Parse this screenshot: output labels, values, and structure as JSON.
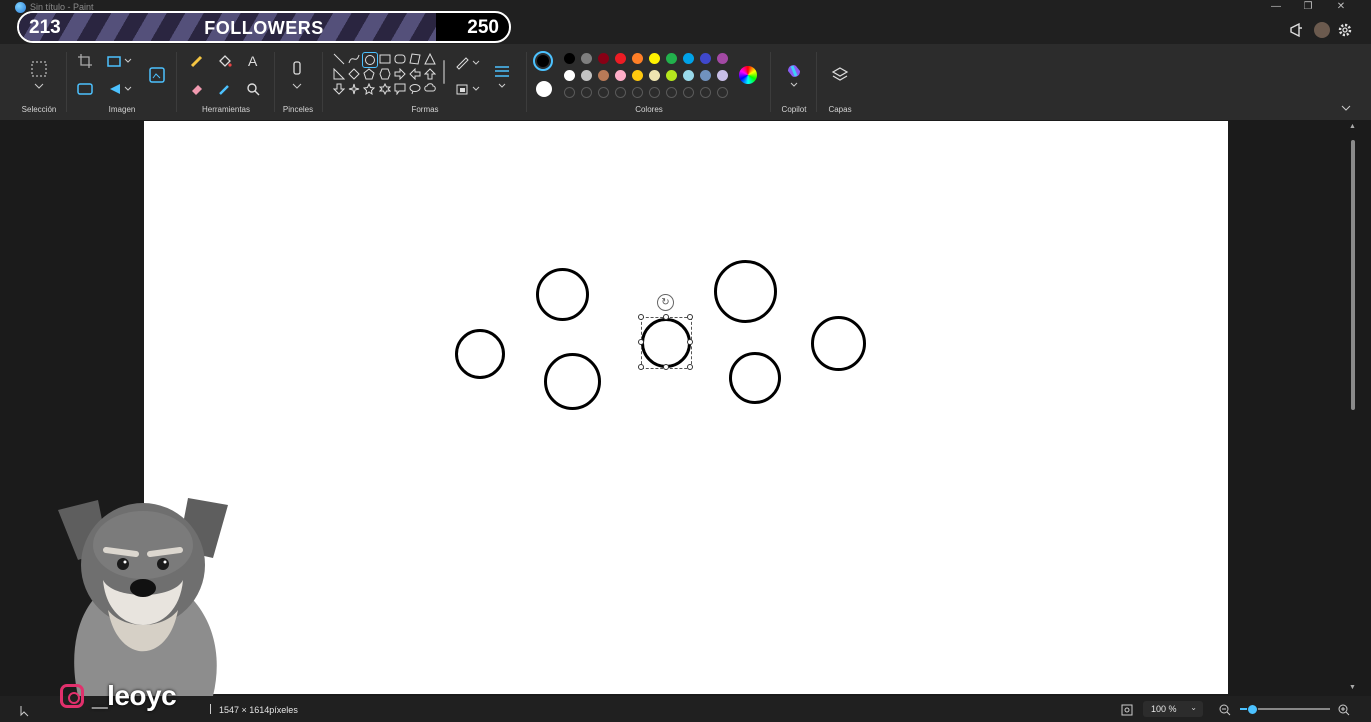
{
  "window": {
    "title": "Sin título - Paint"
  },
  "overlay": {
    "current": "213",
    "label": "FOLLOWERS",
    "goal": "250",
    "progress": 0.852,
    "social_handle": "_leoyc"
  },
  "ribbon": {
    "groups": {
      "selection": "Selección",
      "image": "Imagen",
      "tools": "Herramientas",
      "brushes": "Pinceles",
      "shapes": "Formas",
      "colors": "Colores",
      "copilot": "Copilot",
      "layers": "Capas"
    },
    "palette_row1": [
      "#000000",
      "#7f7f7f",
      "#880015",
      "#ed1c24",
      "#ff7f27",
      "#fff200",
      "#22b14c",
      "#00a2e8",
      "#3f48cc",
      "#a349a4"
    ],
    "palette_row2": [
      "#ffffff",
      "#c3c3c3",
      "#b97a57",
      "#ffaec9",
      "#ffc90e",
      "#efe4b0",
      "#b5e61d",
      "#99d9ea",
      "#7092be",
      "#c8bfe7"
    ],
    "primary_color": "#000000",
    "secondary_color": "#ffffff"
  },
  "status": {
    "canvas_size": "1547 × 1614píxeles",
    "zoom": "100 %"
  },
  "accent": "#4cc2ff"
}
